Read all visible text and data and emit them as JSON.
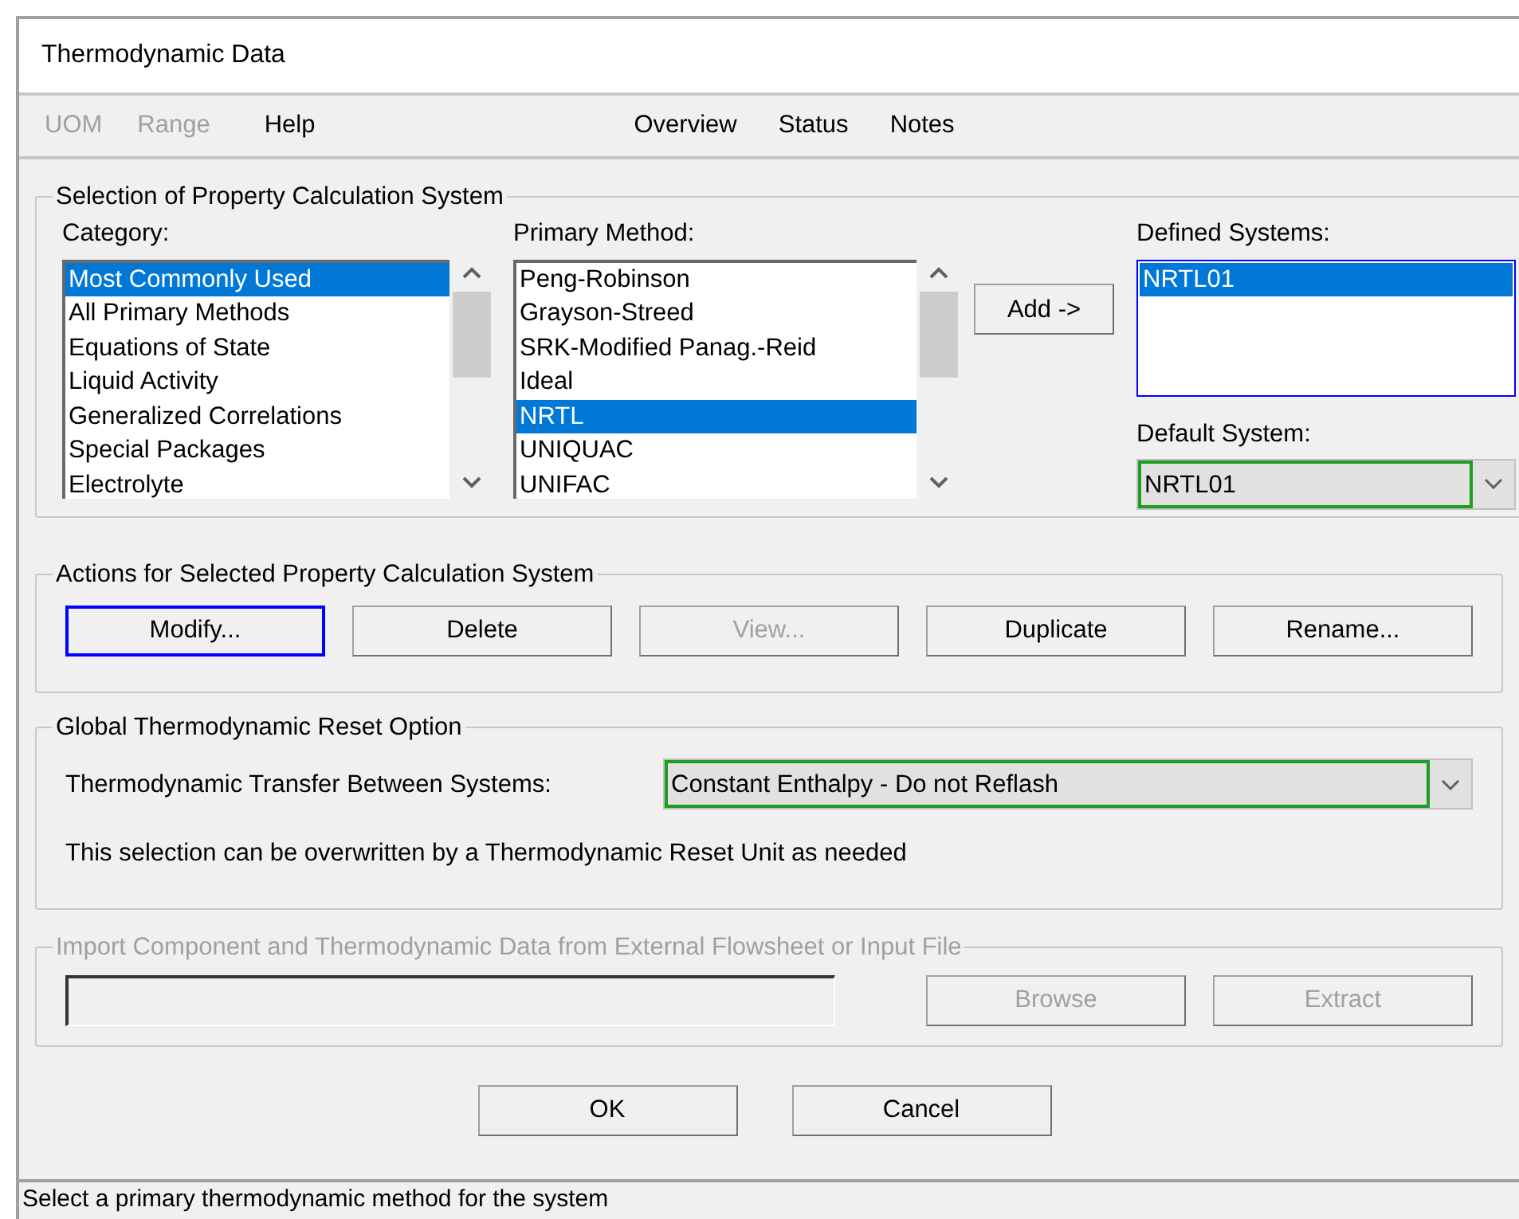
{
  "window": {
    "title": "Thermodynamic Data"
  },
  "menu": [
    {
      "label": "UOM",
      "disabled": true
    },
    {
      "label": "Range",
      "disabled": true
    },
    {
      "label": "Help",
      "disabled": false
    }
  ],
  "view_links": [
    {
      "label": "Overview"
    },
    {
      "label": "Status"
    },
    {
      "label": "Notes"
    }
  ],
  "selection_group": {
    "title": "Selection of Property Calculation System",
    "category": {
      "label": "Category:",
      "items": [
        {
          "label": "Most Commonly Used",
          "selected": true
        },
        {
          "label": "All Primary Methods",
          "selected": false
        },
        {
          "label": "Equations of State",
          "selected": false
        },
        {
          "label": "Liquid Activity",
          "selected": false
        },
        {
          "label": "Generalized Correlations",
          "selected": false
        },
        {
          "label": "Special Packages",
          "selected": false
        },
        {
          "label": "Electrolyte",
          "selected": false
        }
      ]
    },
    "primary_method": {
      "label": "Primary Method:",
      "items": [
        {
          "label": "Peng-Robinson",
          "selected": false
        },
        {
          "label": "Grayson-Streed",
          "selected": false
        },
        {
          "label": "SRK-Modified Panag.-Reid",
          "selected": false
        },
        {
          "label": "Ideal",
          "selected": false
        },
        {
          "label": "NRTL",
          "selected": true
        },
        {
          "label": "UNIQUAC",
          "selected": false
        },
        {
          "label": "UNIFAC",
          "selected": false
        }
      ]
    },
    "add_button": {
      "label": "Add ->"
    },
    "defined_systems": {
      "label": "Defined Systems:",
      "items": [
        {
          "label": "NRTL01",
          "selected": true
        }
      ]
    },
    "default_system": {
      "label": "Default System:",
      "value": "NRTL01"
    }
  },
  "actions_group": {
    "title": "Actions for Selected Property Calculation System",
    "buttons": [
      {
        "label": "Modify...",
        "disabled": false,
        "focused": true
      },
      {
        "label": "Delete",
        "disabled": false,
        "focused": false
      },
      {
        "label": "View...",
        "disabled": true,
        "focused": false
      },
      {
        "label": "Duplicate",
        "disabled": false,
        "focused": false
      },
      {
        "label": "Rename...",
        "disabled": false,
        "focused": false
      }
    ]
  },
  "reset_group": {
    "title": "Global Thermodynamic Reset Option",
    "transfer_label": "Thermodynamic Transfer Between Systems:",
    "transfer_value": "Constant Enthalpy - Do not Reflash",
    "note": "This selection can be overwritten by a Thermodynamic Reset Unit as needed"
  },
  "import_group": {
    "title": "Import Component and Thermodynamic Data from External Flowsheet or Input File",
    "disabled": true,
    "buttons": [
      {
        "label": "Browse",
        "disabled": true
      },
      {
        "label": "Extract",
        "disabled": true
      }
    ]
  },
  "dialog_buttons": [
    {
      "label": "OK"
    },
    {
      "label": "Cancel"
    }
  ],
  "status_bar": "Select a primary thermodynamic method for the system"
}
